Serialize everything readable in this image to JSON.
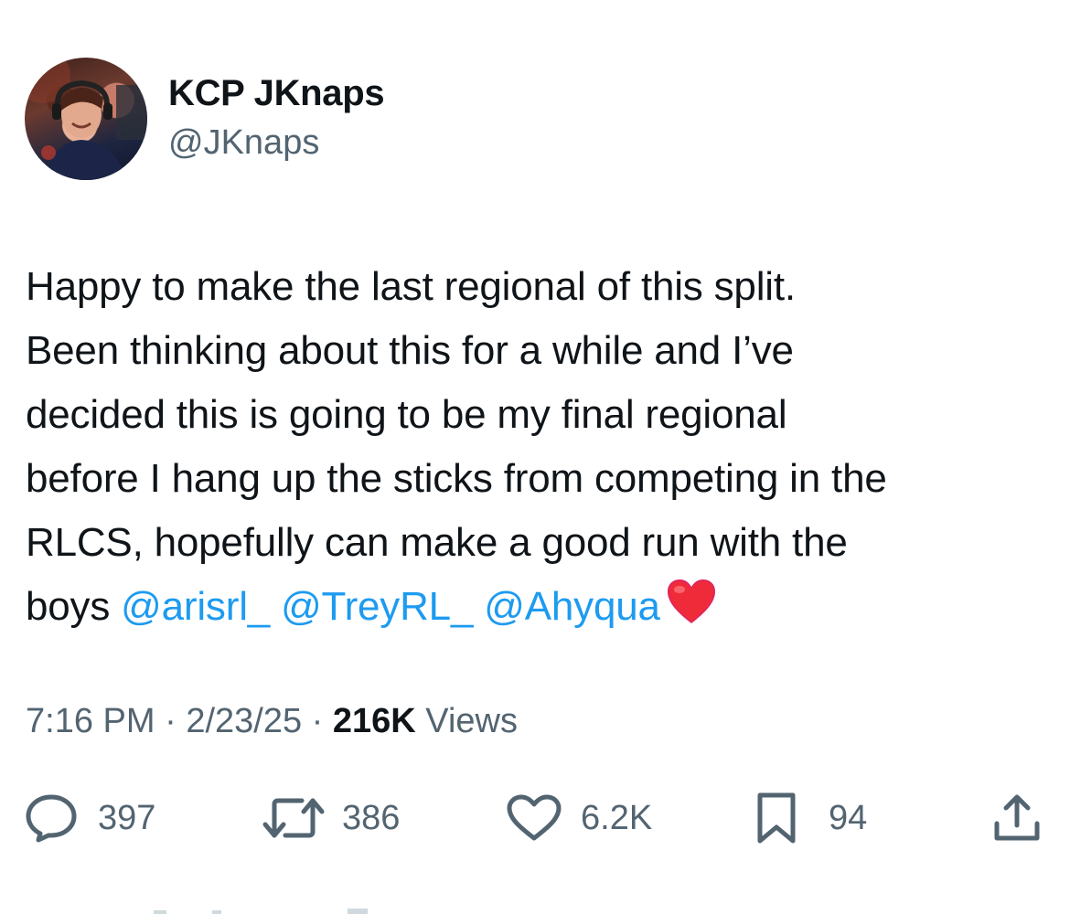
{
  "author": {
    "display_name": "KCP JKnaps",
    "handle": "@JKnaps"
  },
  "tweet": {
    "lines": [
      "Happy to make the last regional of this split.",
      "Been thinking about this for a while and I’ve",
      "decided this is going to be my final regional",
      "before I hang up the sticks from competing in the",
      "RLCS, hopefully can make a good run with the"
    ],
    "last_line_prefix": "boys ",
    "mentions": [
      "@arisrl_",
      "@TreyRL_",
      "@Ahyqua"
    ],
    "emoji": "red-heart"
  },
  "meta": {
    "time": "7:16 PM",
    "separator": " · ",
    "date": "2/23/25",
    "views_count": "216K",
    "views_label": " Views"
  },
  "actions": {
    "replies": "397",
    "reposts": "386",
    "likes": "6.2K",
    "bookmarks": "94"
  },
  "colors": {
    "text": "#0f1419",
    "secondary": "#536471",
    "link": "#1d9bf0",
    "heart": "#e0245e"
  }
}
